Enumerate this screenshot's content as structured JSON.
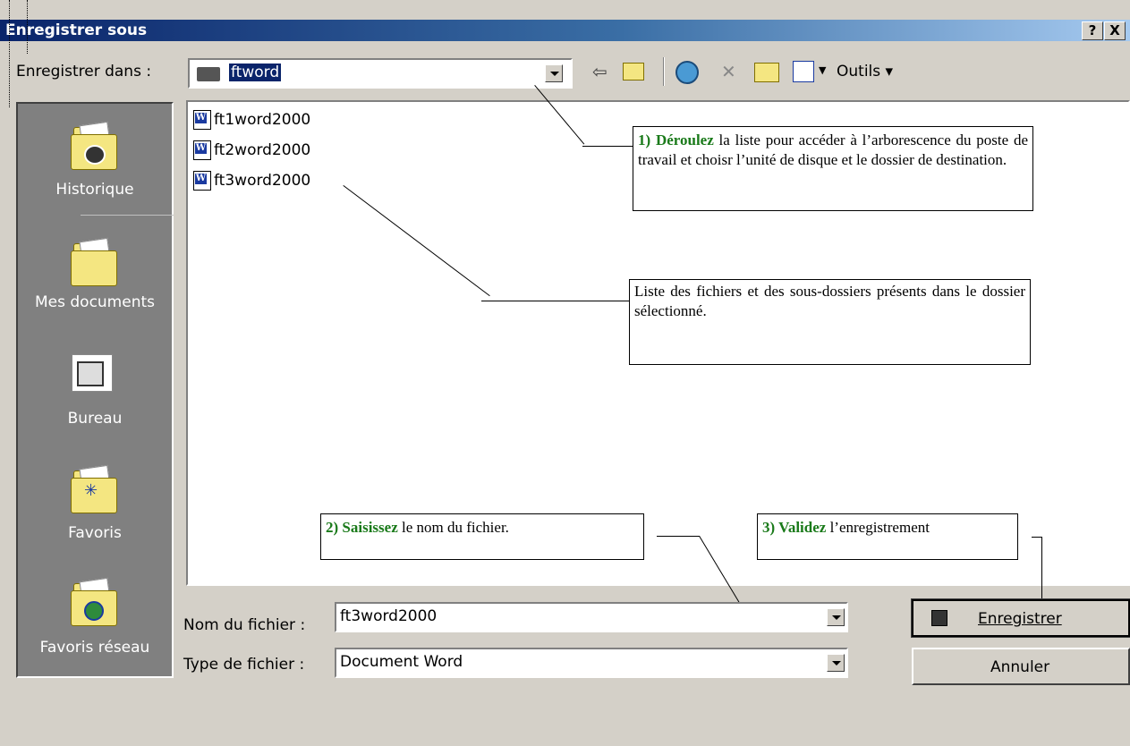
{
  "window": {
    "title": "Enregistrer sous",
    "help_btn": "?",
    "close_btn": "X"
  },
  "toolbar": {
    "save_in_label": "Enregistrer dans :",
    "current_folder": "ftword",
    "tools_label": "Outils"
  },
  "places": [
    {
      "label": "Historique"
    },
    {
      "label": "Mes documents"
    },
    {
      "label": "Bureau"
    },
    {
      "label": "Favoris"
    },
    {
      "label": "Favoris réseau"
    }
  ],
  "files": [
    {
      "name": "ft1word2000"
    },
    {
      "name": "ft2word2000"
    },
    {
      "name": "ft3word2000"
    }
  ],
  "callouts": {
    "c1_bold": "1) Déroulez",
    "c1_text": " la liste pour accéder à l’arborescence du poste de travail et choisr l’unité de disque et le dossier de destination.",
    "c2_text": "Liste des fichiers et des sous-dossiers présents dans le dossier sélectionné.",
    "c3_bold": "2) Saisissez",
    "c3_text": "  le nom du fichier.",
    "c4_bold": "3) Validez",
    "c4_text": "  l’enregistrement"
  },
  "form": {
    "filename_label": "Nom du fichier :",
    "filename_value": "ft3word2000",
    "filetype_label": "Type de fichier :",
    "filetype_value": "Document Word"
  },
  "buttons": {
    "save": "Enregistrer",
    "cancel": "Annuler"
  }
}
